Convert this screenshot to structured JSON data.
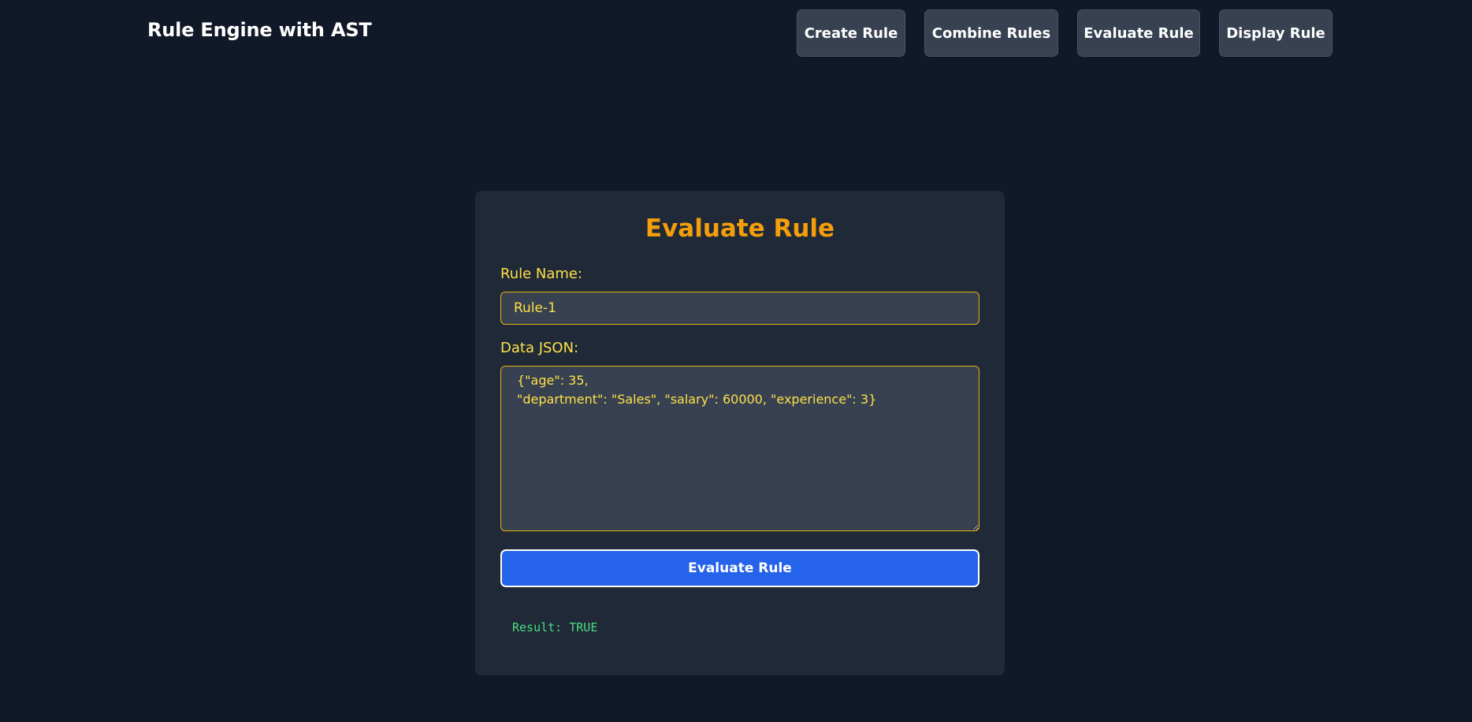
{
  "header": {
    "title": "Rule Engine with AST",
    "nav": {
      "create_label": "Create Rule",
      "combine_label": "Combine Rules",
      "evaluate_label": "Evaluate Rule",
      "display_label": "Display Rule"
    }
  },
  "evaluate_form": {
    "title": "Evaluate Rule",
    "rule_name_label": "Rule Name:",
    "rule_name_value": "Rule-1",
    "data_label": "Data JSON:",
    "data_value": "{\"age\": 35,\n\"department\": \"Sales\", \"salary\": 60000, \"experience\": 3}",
    "submit_label": "Evaluate Rule",
    "result": "Result: TRUE"
  },
  "colors": {
    "background": "#111827",
    "card": "#1f2937",
    "title_accent": "#f59e0b",
    "label": "#fde047",
    "primary_button": "#2563eb",
    "result_text": "#4ade80"
  }
}
